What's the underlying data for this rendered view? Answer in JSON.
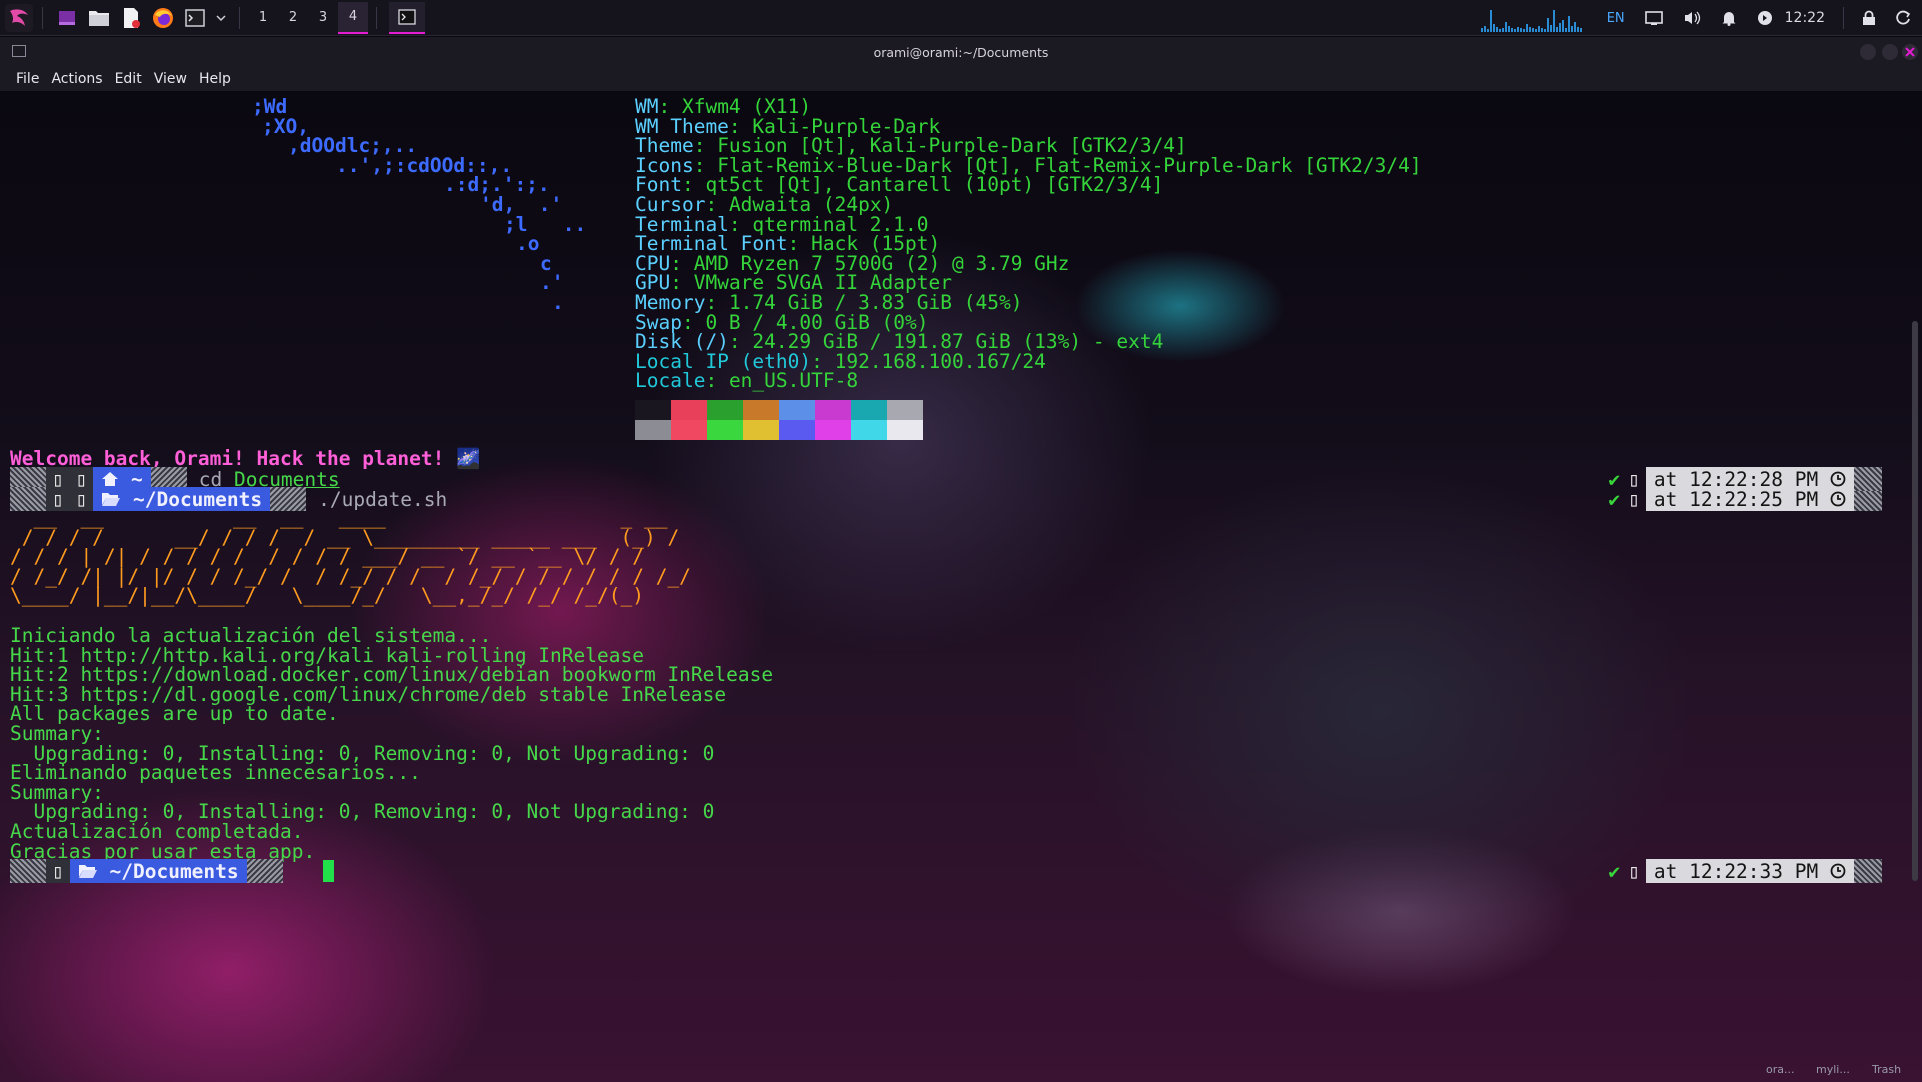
{
  "panel": {
    "workspaces": [
      "1",
      "2",
      "3",
      "4"
    ],
    "active_workspace": "4",
    "keyboard_layout": "EN",
    "clock": "12:22"
  },
  "window": {
    "title": "orami@orami:~/Documents",
    "menus": [
      "File",
      "Actions",
      "Edit",
      "View",
      "Help"
    ]
  },
  "fetch": {
    "logo": [
      ";Wd",
      ";XO,",
      ",dOOdlc;,..",
      "..',;:cdOOd::,.",
      ".:d;.':;.",
      "'d,  .'",
      ";l   ..",
      ".o",
      "c",
      ".'",
      "."
    ],
    "info": [
      {
        "key": "WM",
        "value": "Xfwm4 (X11)"
      },
      {
        "key": "WM Theme",
        "value": "Kali-Purple-Dark"
      },
      {
        "key": "Theme",
        "value": "Fusion [Qt], Kali-Purple-Dark [GTK2/3/4]"
      },
      {
        "key": "Icons",
        "value": "Flat-Remix-Blue-Dark [Qt], Flat-Remix-Purple-Dark [GTK2/3/4]"
      },
      {
        "key": "Font",
        "value": "qt5ct [Qt], Cantarell (10pt) [GTK2/3/4]"
      },
      {
        "key": "Cursor",
        "value": "Adwaita (24px)"
      },
      {
        "key": "Terminal",
        "value": "qterminal 2.1.0"
      },
      {
        "key": "Terminal Font",
        "value": "Hack (15pt)"
      },
      {
        "key": "CPU",
        "value": "AMD Ryzen 7 5700G (2) @ 3.79 GHz"
      },
      {
        "key": "GPU",
        "value": "VMware SVGA II Adapter"
      },
      {
        "key": "Memory",
        "value": "1.74 GiB / 3.83 GiB (45%)"
      },
      {
        "key": "Swap",
        "value": "0 B / 4.00 GiB (0%)"
      },
      {
        "key": "Disk (/)",
        "value": "24.29 GiB / 191.87 GiB (13%) - ext4"
      },
      {
        "key": "Local IP (eth0)",
        "value": "192.168.100.167/24"
      },
      {
        "key": "Locale",
        "value": "en_US.UTF-8"
      }
    ],
    "palette_top": [
      "#1a1620",
      "#e8405a",
      "#2aa02e",
      "#c87a2a",
      "#5c8fe8",
      "#c83ad0",
      "#1aa8b0",
      "#a8a8b0"
    ],
    "palette_bottom": [
      "#8c8c94",
      "#f04860",
      "#3ad83e",
      "#e0c030",
      "#5a5af0",
      "#e040e8",
      "#40d8e8",
      "#e8e8ee"
    ]
  },
  "welcome": "Welcome back, Orami! Hack the planet! 🌌",
  "prompts": [
    {
      "icon": "home-icon",
      "path": "~",
      "command": "cd",
      "arg": "Documents",
      "time": "at 12:22:25 PM"
    },
    {
      "icon": "folder-open-icon",
      "path": "~/Documents",
      "command": "./update.sh",
      "arg": "",
      "time": "at 12:22:28 PM"
    }
  ],
  "banner": [
    "  __  __           __  __   ____                    _ __ ",
    " / / / /      __/ / / /  / __ \\_________ _____ ___  (_) /",
    "/ / / | /| / / / / /  / / / / ___/ __ `/ __ `__ \\/ / / ",
    "/ /_/ /| |/ |/ / / /_/ /  / /_/ / /  / /_/ / / / / / / /_/ ",
    "\\____/ |__/|__/\\____/   \\____/_/   \\__,_/_/ /_/ /_/(_)  "
  ],
  "output": [
    "Iniciando la actualización del sistema...",
    "Hit:1 http://http.kali.org/kali kali-rolling InRelease",
    "Hit:2 https://download.docker.com/linux/debian bookworm InRelease",
    "Hit:3 https://dl.google.com/linux/chrome/deb stable InRelease",
    "All packages are up to date.",
    "Summary:",
    "  Upgrading: 0, Installing: 0, Removing: 0, Not Upgrading: 0",
    "Eliminando paquetes innecesarios...",
    "Summary:",
    "  Upgrading: 0, Installing: 0, Removing: 0, Not Upgrading: 0",
    "Actualización completada.",
    "Gracias por usar esta app."
  ],
  "final_prompt": {
    "path": "~/Documents",
    "time": "at 12:22:33 PM"
  },
  "desktop_labels": [
    "ora...",
    "myli...",
    "Trash"
  ]
}
